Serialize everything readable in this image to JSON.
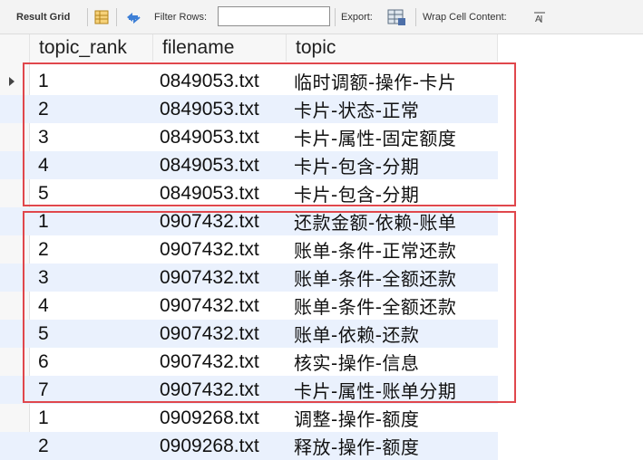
{
  "toolbar": {
    "result_grid_label": "Result Grid",
    "filter_rows_label": "Filter Rows:",
    "filter_rows_value": "",
    "export_label": "Export:",
    "wrap_cell_label": "Wrap Cell Content:",
    "icons": [
      "grid-view-icon",
      "refresh-icon",
      "export-file-icon",
      "wrap-text-icon"
    ]
  },
  "columns": [
    "topic_rank",
    "filename",
    "topic"
  ],
  "rows": [
    {
      "topic_rank": "1",
      "filename": "0849053.txt",
      "topic": "临时调额-操作-卡片"
    },
    {
      "topic_rank": "2",
      "filename": "0849053.txt",
      "topic": "卡片-状态-正常"
    },
    {
      "topic_rank": "3",
      "filename": "0849053.txt",
      "topic": "卡片-属性-固定额度"
    },
    {
      "topic_rank": "4",
      "filename": "0849053.txt",
      "topic": "卡片-包含-分期"
    },
    {
      "topic_rank": "5",
      "filename": "0849053.txt",
      "topic": "卡片-包含-分期"
    },
    {
      "topic_rank": "1",
      "filename": "0907432.txt",
      "topic": "还款金额-依赖-账单"
    },
    {
      "topic_rank": "2",
      "filename": "0907432.txt",
      "topic": "账单-条件-正常还款"
    },
    {
      "topic_rank": "3",
      "filename": "0907432.txt",
      "topic": "账单-条件-全额还款"
    },
    {
      "topic_rank": "4",
      "filename": "0907432.txt",
      "topic": "账单-条件-全额还款"
    },
    {
      "topic_rank": "5",
      "filename": "0907432.txt",
      "topic": "账单-依赖-还款"
    },
    {
      "topic_rank": "6",
      "filename": "0907432.txt",
      "topic": "核实-操作-信息"
    },
    {
      "topic_rank": "7",
      "filename": "0907432.txt",
      "topic": "卡片-属性-账单分期"
    },
    {
      "topic_rank": "1",
      "filename": "0909268.txt",
      "topic": "调整-操作-额度"
    },
    {
      "topic_rank": "2",
      "filename": "0909268.txt",
      "topic": "释放-操作-额度"
    }
  ],
  "highlight_color": "#e0474c",
  "alt_row_color": "#eaf1fd"
}
